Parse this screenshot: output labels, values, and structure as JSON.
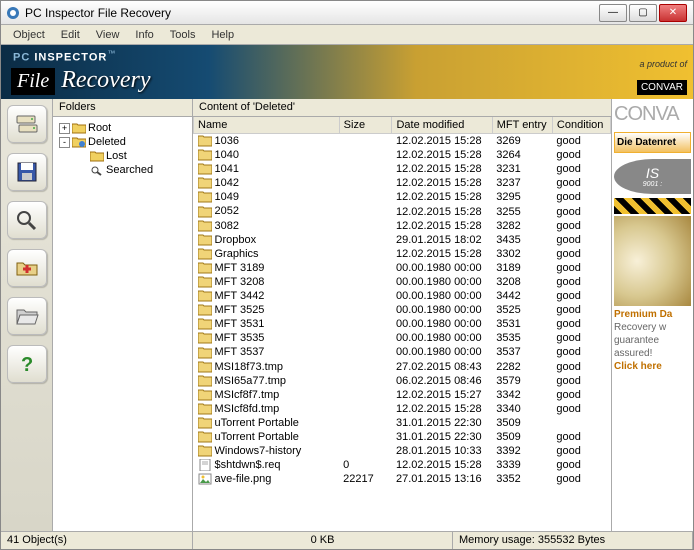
{
  "window": {
    "title": "PC Inspector File Recovery"
  },
  "menu": {
    "items": [
      "Object",
      "Edit",
      "View",
      "Info",
      "Tools",
      "Help"
    ]
  },
  "banner": {
    "pc": "PC",
    "inspector": " INSPECTOR",
    "tm": "™",
    "file": "File",
    "recovery": "Recovery",
    "product_of": "a product of",
    "convar": "CONVAR"
  },
  "folders": {
    "header": "Folders",
    "items": [
      {
        "label": "Root",
        "indent": 0,
        "expander": "+",
        "icon": "folder"
      },
      {
        "label": "Deleted",
        "indent": 0,
        "expander": "-",
        "icon": "folder-recycle"
      },
      {
        "label": "Lost",
        "indent": 1,
        "expander": "",
        "icon": "folder"
      },
      {
        "label": "Searched",
        "indent": 1,
        "expander": "",
        "icon": "search"
      }
    ]
  },
  "content": {
    "header": "Content of 'Deleted'",
    "columns": [
      "Name",
      "Size",
      "Date modified",
      "MFT entry",
      "Condition"
    ],
    "col_widths": [
      "138px",
      "50px",
      "95px",
      "57px",
      "55px"
    ],
    "rows": [
      {
        "icon": "folder",
        "name": "1036",
        "size": "",
        "date": "12.02.2015 15:28",
        "mft": "3269",
        "cond": "good"
      },
      {
        "icon": "folder",
        "name": "1040",
        "size": "",
        "date": "12.02.2015 15:28",
        "mft": "3264",
        "cond": "good"
      },
      {
        "icon": "folder",
        "name": "1041",
        "size": "",
        "date": "12.02.2015 15:28",
        "mft": "3231",
        "cond": "good"
      },
      {
        "icon": "folder",
        "name": "1042",
        "size": "",
        "date": "12.02.2015 15:28",
        "mft": "3237",
        "cond": "good"
      },
      {
        "icon": "folder",
        "name": "1049",
        "size": "",
        "date": "12.02.2015 15:28",
        "mft": "3295",
        "cond": "good"
      },
      {
        "icon": "folder",
        "name": "2052",
        "size": "",
        "date": "12.02.2015 15:28",
        "mft": "3255",
        "cond": "good"
      },
      {
        "icon": "folder",
        "name": "3082",
        "size": "",
        "date": "12.02.2015 15:28",
        "mft": "3282",
        "cond": "good"
      },
      {
        "icon": "folder",
        "name": "Dropbox",
        "size": "",
        "date": "29.01.2015 18:02",
        "mft": "3435",
        "cond": "good"
      },
      {
        "icon": "folder",
        "name": "Graphics",
        "size": "",
        "date": "12.02.2015 15:28",
        "mft": "3302",
        "cond": "good"
      },
      {
        "icon": "folder",
        "name": "MFT 3189",
        "size": "",
        "date": "00.00.1980 00:00",
        "mft": "3189",
        "cond": "good"
      },
      {
        "icon": "folder",
        "name": "MFT 3208",
        "size": "",
        "date": "00.00.1980 00:00",
        "mft": "3208",
        "cond": "good"
      },
      {
        "icon": "folder",
        "name": "MFT 3442",
        "size": "",
        "date": "00.00.1980 00:00",
        "mft": "3442",
        "cond": "good"
      },
      {
        "icon": "folder",
        "name": "MFT 3525",
        "size": "",
        "date": "00.00.1980 00:00",
        "mft": "3525",
        "cond": "good"
      },
      {
        "icon": "folder",
        "name": "MFT 3531",
        "size": "",
        "date": "00.00.1980 00:00",
        "mft": "3531",
        "cond": "good"
      },
      {
        "icon": "folder",
        "name": "MFT 3535",
        "size": "",
        "date": "00.00.1980 00:00",
        "mft": "3535",
        "cond": "good"
      },
      {
        "icon": "folder",
        "name": "MFT 3537",
        "size": "",
        "date": "00.00.1980 00:00",
        "mft": "3537",
        "cond": "good"
      },
      {
        "icon": "folder",
        "name": "MSI18f73.tmp",
        "size": "",
        "date": "27.02.2015 08:43",
        "mft": "2282",
        "cond": "good"
      },
      {
        "icon": "folder",
        "name": "MSI65a77.tmp",
        "size": "",
        "date": "06.02.2015 08:46",
        "mft": "3579",
        "cond": "good"
      },
      {
        "icon": "folder",
        "name": "MSIcf8f7.tmp",
        "size": "",
        "date": "12.02.2015 15:27",
        "mft": "3342",
        "cond": "good"
      },
      {
        "icon": "folder",
        "name": "MSIcf8fd.tmp",
        "size": "",
        "date": "12.02.2015 15:28",
        "mft": "3340",
        "cond": "good"
      },
      {
        "icon": "folder",
        "name": "uTorrent Portable",
        "size": "",
        "date": "31.01.2015 22:30",
        "mft": "3509",
        "cond": ""
      },
      {
        "icon": "folder",
        "name": "uTorrent Portable",
        "size": "",
        "date": "31.01.2015 22:30",
        "mft": "3509",
        "cond": "good"
      },
      {
        "icon": "folder",
        "name": "Windows7-history",
        "size": "",
        "date": "28.01.2015 10:33",
        "mft": "3392",
        "cond": "good"
      },
      {
        "icon": "file",
        "name": "$shtdwn$.req",
        "size": "0",
        "date": "12.02.2015 15:28",
        "mft": "3339",
        "cond": "good"
      },
      {
        "icon": "image",
        "name": "ave-file.png",
        "size": "22217",
        "date": "27.01.2015 13:16",
        "mft": "3352",
        "cond": "good"
      }
    ]
  },
  "ad": {
    "convar": "CONVA",
    "daten": "Die Datenret",
    "iso": "IS",
    "iso_small": "9001 :",
    "lines": [
      "Premium Da",
      "Recovery w",
      "guarantee",
      "assured!",
      "Click here"
    ]
  },
  "status": {
    "objects": "41 Object(s)",
    "size": "0 KB",
    "memory": "Memory usage: 355532 Bytes"
  },
  "sidebar_icons": [
    "drives-icon",
    "save-icon",
    "search-icon",
    "recover-icon",
    "open-icon",
    "help-icon"
  ]
}
